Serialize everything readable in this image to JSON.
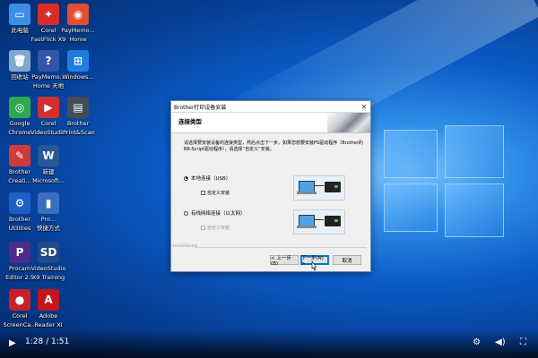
{
  "desktop_icons": [
    {
      "label1": "此电脑",
      "label2": "",
      "glyph": "▭",
      "color": "#3a8ee6"
    },
    {
      "label1": "Corel",
      "label2": "FastFlick X9",
      "glyph": "✦",
      "color": "#d72c2c"
    },
    {
      "label1": "PayMemo...",
      "label2": "Home",
      "glyph": "◉",
      "color": "#e05030"
    },
    {
      "label1": "回收站",
      "label2": "",
      "glyph": "🗑",
      "color": "#7fa8cc"
    },
    {
      "label1": "PayMemo...",
      "label2": "Home 天地",
      "glyph": "?",
      "color": "#3355aa"
    },
    {
      "label1": "Windows...",
      "label2": "",
      "glyph": "⊞",
      "color": "#1e7fe0"
    },
    {
      "label1": "Google",
      "label2": "Chrome",
      "glyph": "◎",
      "color": "#2fa84f"
    },
    {
      "label1": "Corel",
      "label2": "VideoStudi...",
      "glyph": "▶",
      "color": "#d0302f"
    },
    {
      "label1": "Brother",
      "label2": "iPrint&Scan",
      "glyph": "▤",
      "color": "#444c58"
    },
    {
      "label1": "Brother",
      "label2": "Creati...",
      "glyph": "✎",
      "color": "#d23a3a"
    },
    {
      "label1": "新建",
      "label2": "Microsoft...",
      "glyph": "W",
      "color": "#2b5797"
    },
    {
      "label1": "Brother",
      "label2": "Utilities",
      "glyph": "⚙",
      "color": "#1f5fc4"
    },
    {
      "label1": "Pro...",
      "label2": "快捷方式",
      "glyph": "▮",
      "color": "#3a6fc0"
    },
    {
      "label1": "Procam",
      "label2": "Editor 2.5",
      "glyph": "P",
      "color": "#4a2b8c"
    },
    {
      "label1": "VideoStudio",
      "label2": "X9 Training",
      "glyph": "SD",
      "color": "#224a86"
    },
    {
      "label1": "Corel",
      "label2": "ScreenCa...",
      "glyph": "●",
      "color": "#c8202a"
    },
    {
      "label1": "Adobe",
      "label2": "Reader XI",
      "glyph": "A",
      "color": "#c4141c"
    }
  ],
  "dialog": {
    "title": "Brother打印设备安装",
    "close": "✕",
    "heading": "连接类型",
    "description": "请选择要安装设备的连接类型，然后点击下一步。如果您想要安装PS驱动程序（Brother的BR-Script驱动程序），请选择“自定义”安装。",
    "options": [
      {
        "label": "本地连接（USB）",
        "selected": true,
        "custom": "自定义安装",
        "custom_enabled": true
      },
      {
        "label": "有线网络连接（以太网）",
        "selected": false,
        "custom": "自定义安装",
        "custom_enabled": false
      }
    ],
    "installshield": "InstallShield",
    "buttons": {
      "back": "< 上一步(B)",
      "next": "下一步(N) >",
      "cancel": "取消"
    }
  },
  "video": {
    "play_icon": "▶",
    "time": "1:28 / 1:51",
    "controls": [
      "⚙",
      "◀︎)",
      "⛶"
    ]
  }
}
